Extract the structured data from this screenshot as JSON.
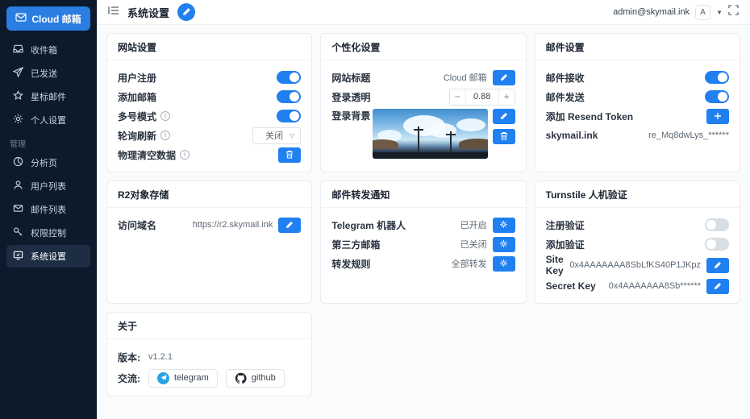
{
  "colors": {
    "accent": "#2080f0",
    "sidebar_bg": "#0c1a2b",
    "toggle_off": "#d9dee4"
  },
  "app": {
    "logo_label": "Cloud 邮箱",
    "logo_icon": "envelope-icon"
  },
  "sidebar": {
    "main_items": [
      {
        "label": "收件箱",
        "icon": "inbox-icon"
      },
      {
        "label": "已发送",
        "icon": "send-icon"
      },
      {
        "label": "星标邮件",
        "icon": "star-icon"
      },
      {
        "label": "个人设置",
        "icon": "gear-icon"
      }
    ],
    "section_label": "管理",
    "admin_items": [
      {
        "label": "分析页",
        "icon": "pie-chart-icon"
      },
      {
        "label": "用户列表",
        "icon": "user-icon"
      },
      {
        "label": "邮件列表",
        "icon": "mail-list-icon"
      },
      {
        "label": "权限控制",
        "icon": "key-icon"
      },
      {
        "label": "系统设置",
        "icon": "system-settings-icon",
        "active": true
      }
    ]
  },
  "header": {
    "title": "系统设置",
    "collapse_icon": "menu-fold-icon",
    "edit_icon": "pencil-icon",
    "user_email": "admin@skymail.ink",
    "avatar_text": "A",
    "caret_icon": "chevron-down-icon",
    "fullscreen_icon": "fullscreen-icon"
  },
  "cards": {
    "website": {
      "title": "网站设置",
      "rows": [
        {
          "label": "用户注册",
          "control": "toggle",
          "state": "on"
        },
        {
          "label": "添加邮箱",
          "control": "toggle",
          "state": "on"
        },
        {
          "label": "多号模式",
          "info": true,
          "control": "toggle",
          "state": "on"
        },
        {
          "label": "轮询刷新",
          "info": true,
          "control": "select",
          "value": "关闭"
        },
        {
          "label": "物理清空数据",
          "info": true,
          "control": "delete-button"
        }
      ]
    },
    "personal": {
      "title": "个性化设置",
      "site_title_label": "网站标题",
      "site_title_value": "Cloud 邮箱",
      "opacity_label": "登录透明",
      "opacity_value": "0.88",
      "stepper_minus": "−",
      "stepper_plus": "+",
      "bg_label": "登录背景",
      "bg_image": "anime-sky-landscape-thumbnail"
    },
    "mail": {
      "title": "邮件设置",
      "rows": [
        {
          "label": "邮件接收",
          "control": "toggle",
          "state": "on"
        },
        {
          "label": "邮件发送",
          "control": "toggle",
          "state": "on"
        },
        {
          "label": "添加 Resend Token",
          "control": "add-button"
        },
        {
          "label": "skymail.ink",
          "value": "re_Mq8dwLys_******"
        }
      ]
    },
    "r2": {
      "title": "R2对象存储",
      "domain_label": "访问域名",
      "domain_value": "https://r2.skymail.ink"
    },
    "forward": {
      "title": "邮件转发通知",
      "rows": [
        {
          "label": "Telegram 机器人",
          "value": "已开启",
          "control": "gear-button"
        },
        {
          "label": "第三方邮箱",
          "value": "已关闭",
          "control": "gear-button"
        },
        {
          "label": "转发规则",
          "value": "全部转发",
          "control": "gear-button"
        }
      ]
    },
    "turnstile": {
      "title": "Turnstile 人机验证",
      "rows": [
        {
          "label": "注册验证",
          "control": "toggle",
          "state": "off"
        },
        {
          "label": "添加验证",
          "control": "toggle",
          "state": "off"
        },
        {
          "label": "Site Key",
          "value": "0x4AAAAAAA8SbLfKS40P1JKpz",
          "control": "edit-button"
        },
        {
          "label": "Secret Key",
          "value": "0x4AAAAAAA8Sb******",
          "control": "edit-button"
        }
      ]
    },
    "about": {
      "title": "关于",
      "version_label": "版本:",
      "version_value": "v1.2.1",
      "contact_label": "交流:",
      "links": [
        {
          "label": "telegram",
          "icon": "telegram-icon"
        },
        {
          "label": "github",
          "icon": "github-icon"
        }
      ]
    }
  }
}
